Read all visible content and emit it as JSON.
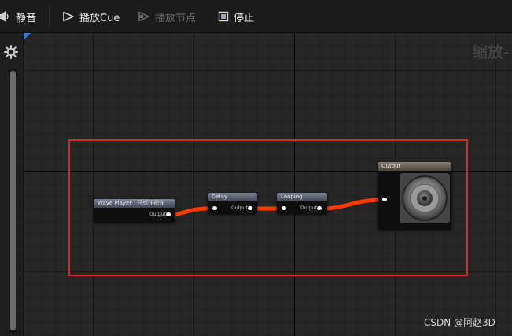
{
  "toolbar": {
    "mute_label": "静音",
    "play_cue_label": "播放Cue",
    "play_node_label": "播放节点",
    "stop_label": "停止"
  },
  "graph": {
    "zoom_label": "缩放-",
    "wire_color": "#ff3a00",
    "selection_color": "#d42a2a",
    "nodes": {
      "wave_player": {
        "title": "Wave Player : 只想注视你",
        "output_label": "Output"
      },
      "delay": {
        "title": "Delay",
        "output_label": "Output"
      },
      "looping": {
        "title": "Looping",
        "output_label": "Output"
      },
      "output": {
        "title": "Output"
      }
    }
  },
  "watermark": "CSDN @阿赵3D"
}
